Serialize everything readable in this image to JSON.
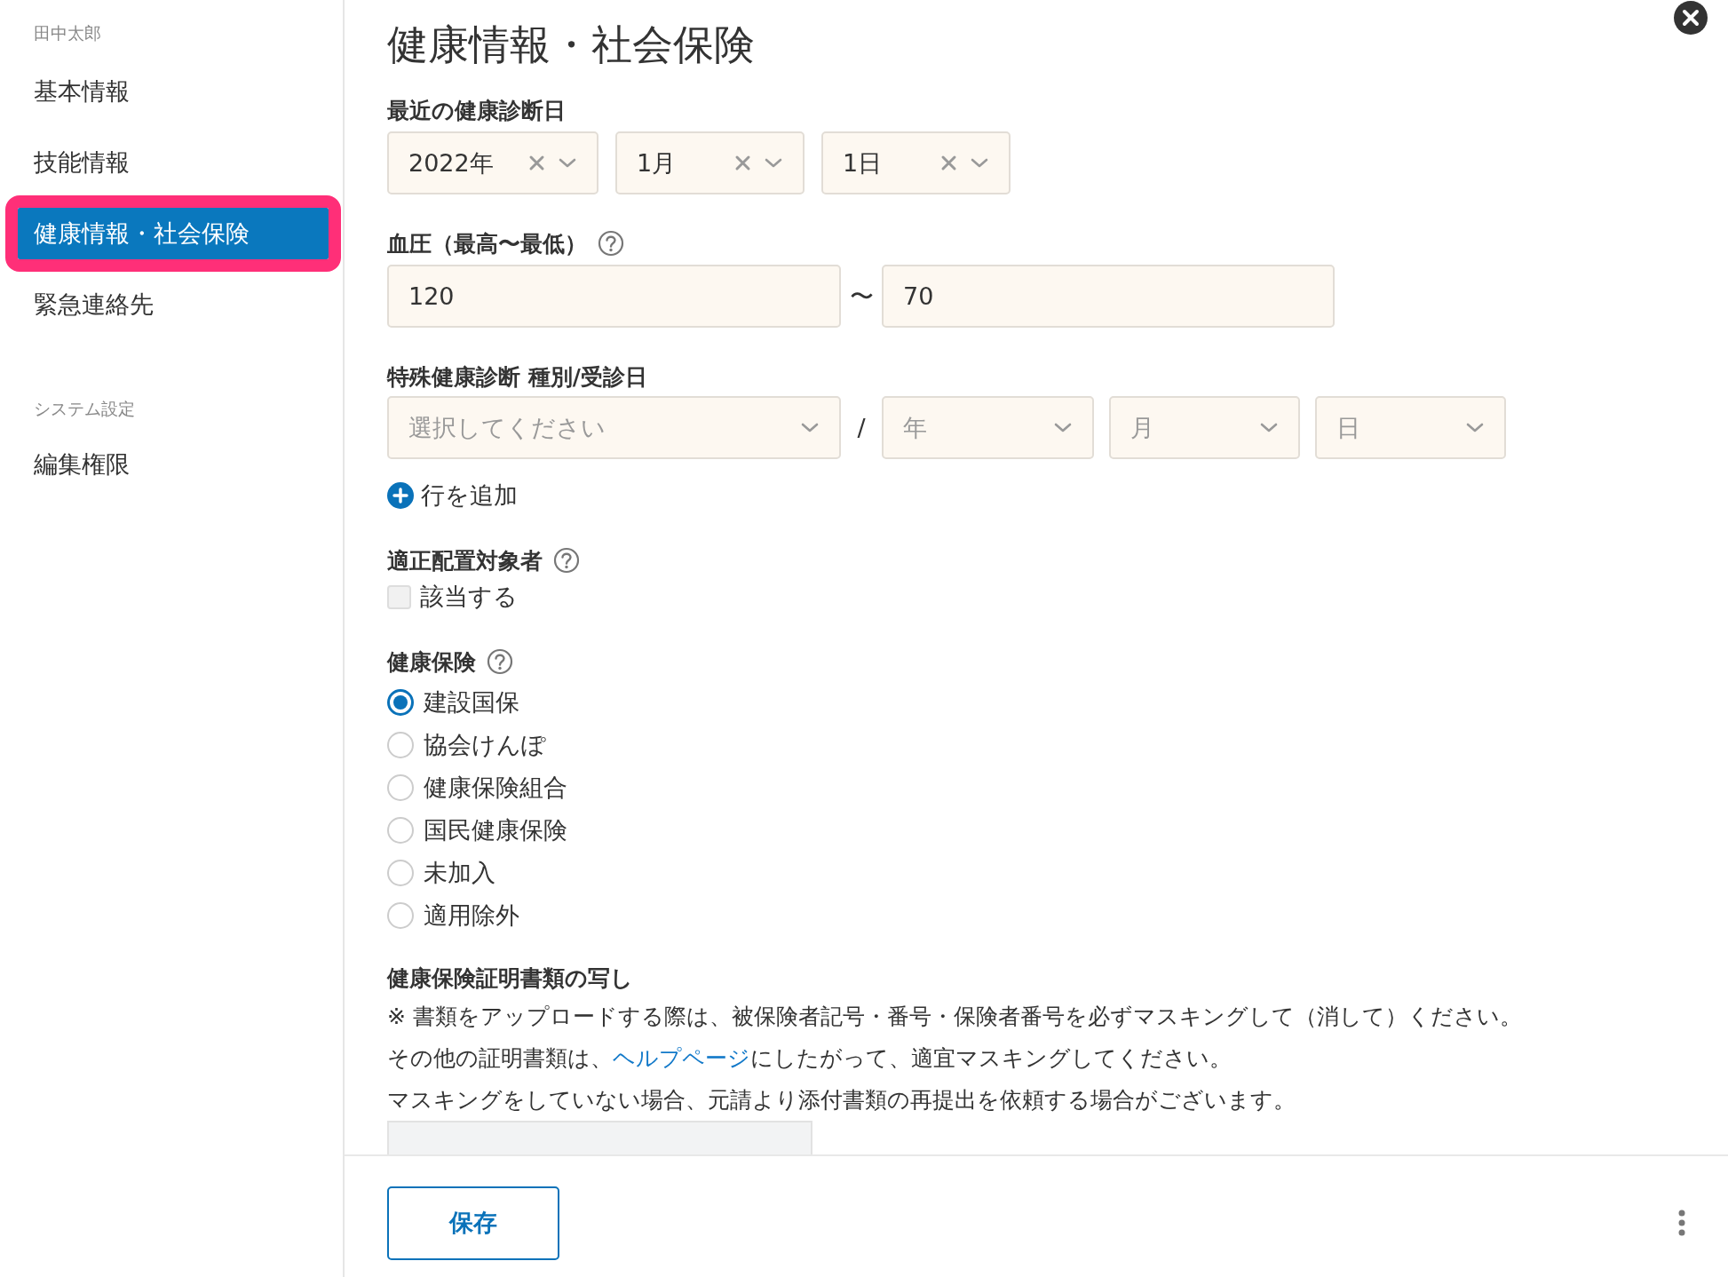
{
  "sidebar": {
    "user_name": "田中太郎",
    "items": [
      {
        "label": "基本情報",
        "selected": false
      },
      {
        "label": "技能情報",
        "selected": false
      },
      {
        "label": "健康情報・社会保険",
        "selected": true
      },
      {
        "label": "緊急連絡先",
        "selected": false
      }
    ],
    "section_title": "システム設定",
    "section_items": [
      {
        "label": "編集権限",
        "selected": false
      }
    ]
  },
  "title": "健康情報・社会保険",
  "checkup_date": {
    "label": "最近の健康診断日",
    "selects": [
      {
        "value": "2022年"
      },
      {
        "value": "1月"
      },
      {
        "value": "1日"
      }
    ]
  },
  "blood_pressure": {
    "label": "血圧（最高〜最低）",
    "help": true,
    "high": "120",
    "separator": "〜",
    "low": "70"
  },
  "special_checkup": {
    "label": "特殊健康診断 種別/受診日",
    "selects": [
      {
        "placeholder": "選択してください"
      },
      {
        "placeholder": "年"
      },
      {
        "placeholder": "月"
      },
      {
        "placeholder": "日"
      }
    ],
    "separator": "/",
    "add_row": "行を追加"
  },
  "proper_placement": {
    "label": "適正配置対象者",
    "help": true,
    "checkbox": {
      "label": "該当する",
      "checked": false
    }
  },
  "health_insurance": {
    "label": "健康保険",
    "help": true,
    "options": [
      {
        "label": "建設国保",
        "selected": true
      },
      {
        "label": "協会けんぽ",
        "selected": false
      },
      {
        "label": "健康保険組合",
        "selected": false
      },
      {
        "label": "国民健康保険",
        "selected": false
      },
      {
        "label": "未加入",
        "selected": false
      },
      {
        "label": "適用除外",
        "selected": false
      }
    ]
  },
  "certificate": {
    "label": "健康保険証明書類の写し",
    "note": "※ 書類をアップロードする際は、被保険者記号・番号・保険者番号を必ずマスキングして（消して）ください。",
    "help_line": {
      "before": "その他の証明書類は、",
      "link": "ヘルプページ",
      "after": "にしたがって、適宜マスキングしてください。"
    },
    "warning": "マスキングをしていない場合、元請より添付書類の再提出を依頼する場合がございます。"
  },
  "footer": {
    "save_button": "保存"
  }
}
